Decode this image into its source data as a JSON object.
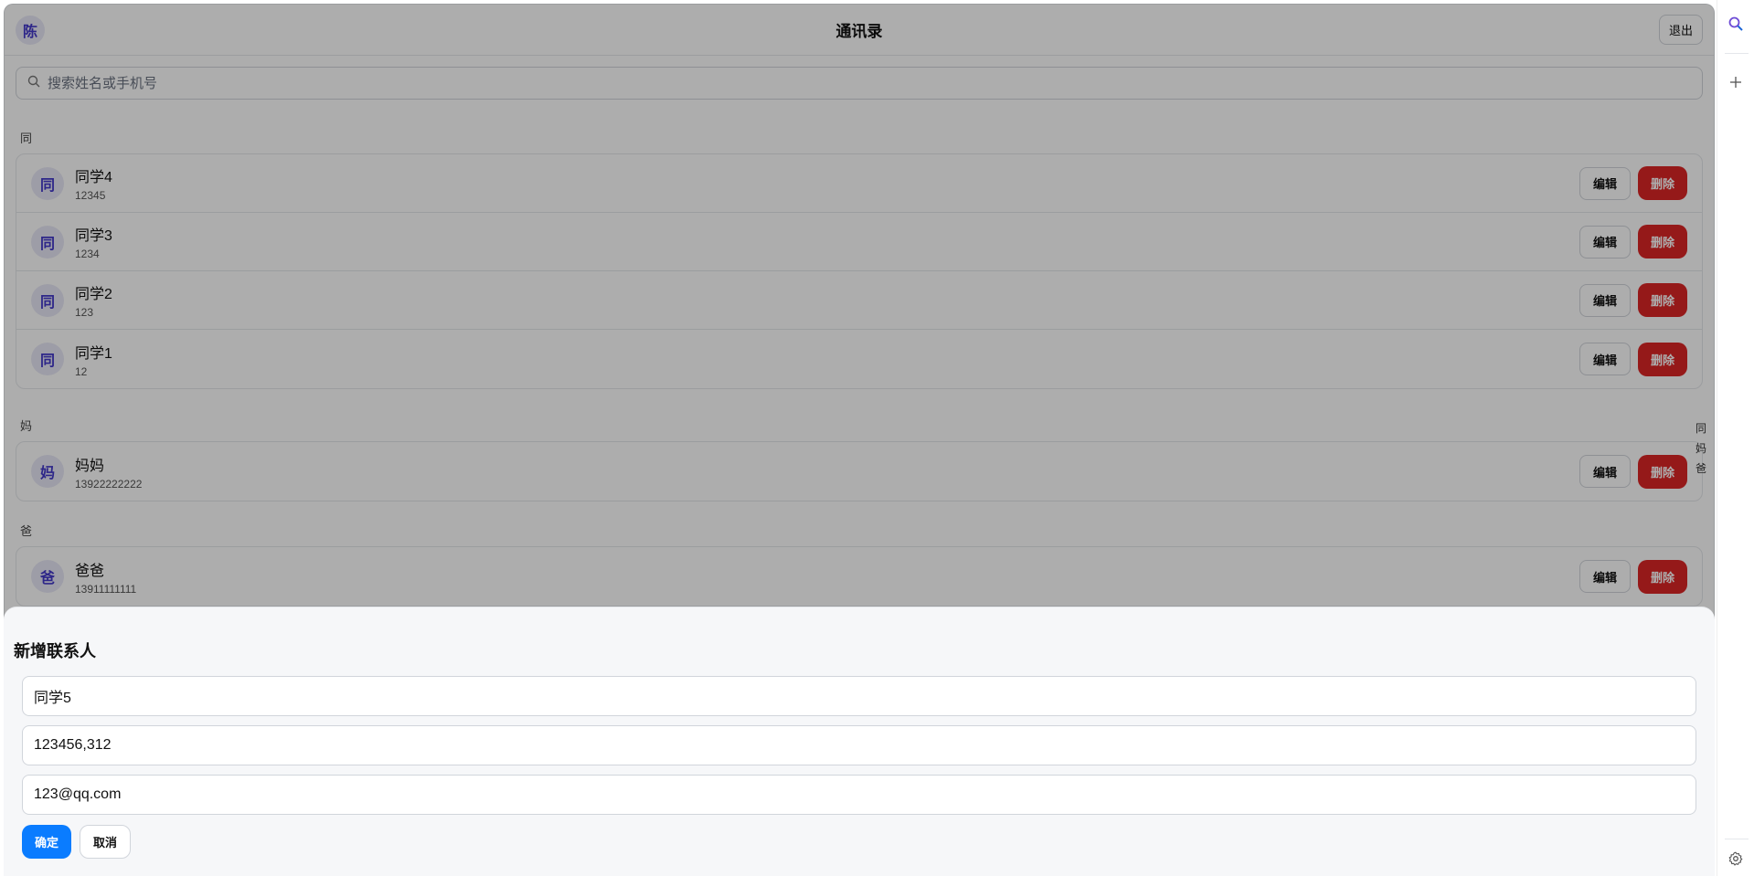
{
  "header": {
    "avatar": "陈",
    "title": "通讯录",
    "logout": "退出"
  },
  "search": {
    "placeholder": "搜索姓名或手机号"
  },
  "groups": [
    {
      "letter": "同",
      "contacts": [
        {
          "avatar": "同",
          "name": "同学4",
          "phone": "12345"
        },
        {
          "avatar": "同",
          "name": "同学3",
          "phone": "1234"
        },
        {
          "avatar": "同",
          "name": "同学2",
          "phone": "123"
        },
        {
          "avatar": "同",
          "name": "同学1",
          "phone": "12"
        }
      ]
    },
    {
      "letter": "妈",
      "contacts": [
        {
          "avatar": "妈",
          "name": "妈妈",
          "phone": "13922222222"
        }
      ]
    },
    {
      "letter": "爸",
      "contacts": [
        {
          "avatar": "爸",
          "name": "爸爸",
          "phone": "13911111111"
        }
      ]
    }
  ],
  "actions": {
    "edit": "编辑",
    "delete": "删除"
  },
  "index_bar": [
    "同",
    "妈",
    "爸"
  ],
  "sheet": {
    "title": "新增联系人",
    "name_value": "同学5",
    "phone_value": "123456,312",
    "email_value": "123@qq.com",
    "confirm": "确定",
    "cancel": "取消"
  },
  "rail": {
    "icons": [
      "search-icon",
      "plus-icon",
      "settings-icon"
    ]
  },
  "colors": {
    "accent": "#0a7cff",
    "danger": "#dc2626",
    "avatar_bg": "#e8e8f6",
    "avatar_fg": "#4338ca"
  }
}
